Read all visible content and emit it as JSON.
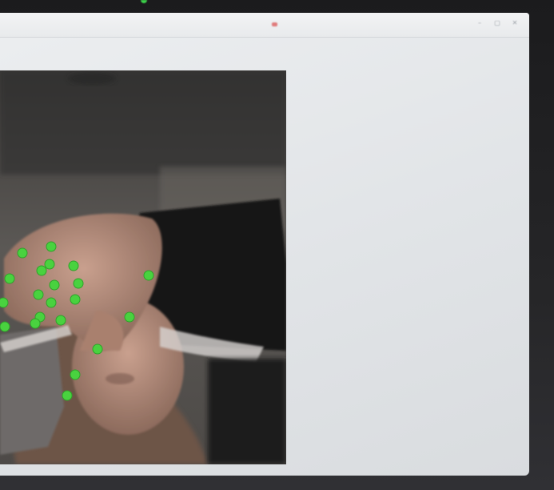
{
  "window": {
    "title": "",
    "controls": [
      "minimize",
      "maximize",
      "close"
    ],
    "control_glyphs": {
      "minimize": "–",
      "maximize": "▢",
      "close": "✕"
    }
  },
  "video_feed": {
    "hand_landmark_color": "#49d23f",
    "hand_landmark_count": 21
  },
  "colors": {
    "screen_bg": "#e4e7ea",
    "bezel": "#222224",
    "landmark": "#49d23f"
  }
}
